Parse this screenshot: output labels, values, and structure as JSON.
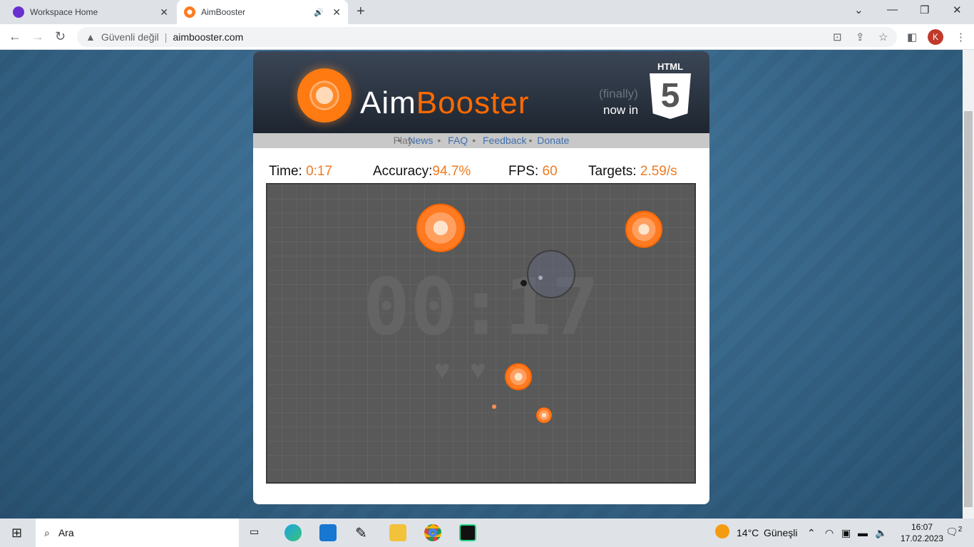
{
  "browser": {
    "tabs": [
      {
        "title": "Workspace Home",
        "active": false,
        "icon": "workspace-icon"
      },
      {
        "title": "AimBooster",
        "active": true,
        "icon": "aimbooster-icon",
        "audio": true
      }
    ],
    "security_label": "Güvenli değil",
    "url": "aimbooster.com",
    "profile_initial": "K"
  },
  "site": {
    "brand_part1": "Aim",
    "brand_part2": "Booster",
    "finally": "(finally)",
    "now_in": "now in",
    "html_label": "HTML",
    "html_version": "5",
    "menu": [
      {
        "label": "Play",
        "current": true
      },
      {
        "label": "News"
      },
      {
        "label": "FAQ"
      },
      {
        "label": "Feedback"
      },
      {
        "label": "Donate"
      }
    ]
  },
  "stats": {
    "time_label": "Time:",
    "time": "0:17",
    "accuracy_label": "Accuracy:",
    "accuracy": "94.7%",
    "fps_label": "FPS:",
    "fps": "60",
    "targets_label": "Targets:",
    "targets": "2.59/s"
  },
  "game": {
    "timer": "00:17",
    "lives": 2,
    "accent": "#ff6a00"
  },
  "taskbar": {
    "search_placeholder": "Ara",
    "weather": "14°C",
    "weather_desc": "Güneşli",
    "time": "16:07",
    "date": "17.02.2023",
    "notifications": "2"
  }
}
